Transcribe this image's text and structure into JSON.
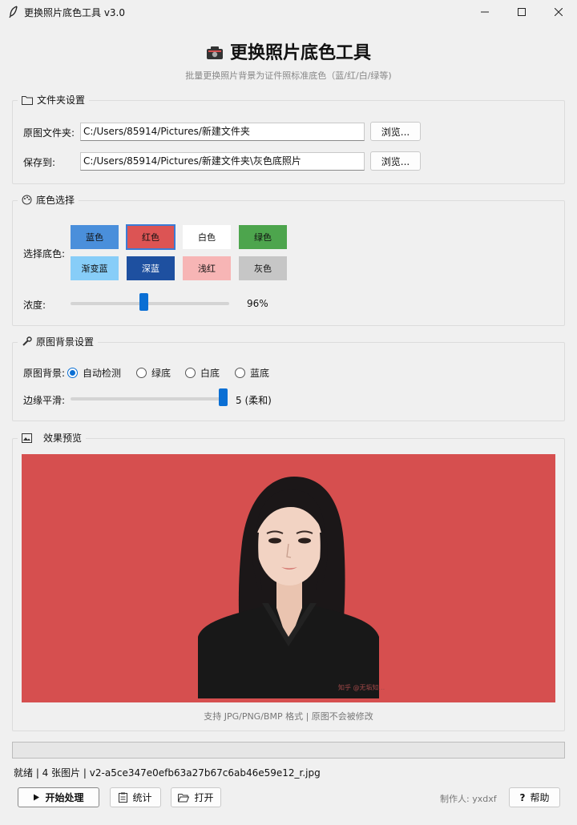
{
  "window": {
    "title": "更换照片底色工具 v3.0"
  },
  "header": {
    "title": "更换照片底色工具",
    "subtitle": "批量更换照片背景为证件照标准底色（蓝/红/白/绿等)"
  },
  "folders": {
    "legend": "文件夹设置",
    "source_label": "原图文件夹:",
    "source_value": "C:/Users/85914/Pictures/新建文件夹",
    "save_label": "保存到:",
    "save_value": "C:/Users/85914/Pictures/新建文件夹\\灰色底照片",
    "browse_label": "浏览..."
  },
  "colors": {
    "legend": "底色选择",
    "choose_label": "选择底色:",
    "swatches": [
      {
        "label": "蓝色",
        "bg": "#4a8fdb",
        "fg": "#111111"
      },
      {
        "label": "红色",
        "bg": "#dc5454",
        "fg": "#111111"
      },
      {
        "label": "白色",
        "bg": "#ffffff",
        "fg": "#111111"
      },
      {
        "label": "绿色",
        "bg": "#4da54d",
        "fg": "#111111"
      },
      {
        "label": "渐变蓝",
        "bg": "#87cdf8",
        "fg": "#111111"
      },
      {
        "label": "深蓝",
        "bg": "#1e50a0",
        "fg": "#ffffff"
      },
      {
        "label": "浅红",
        "bg": "#f7b5b5",
        "fg": "#111111"
      },
      {
        "label": "灰色",
        "bg": "#c6c6c6",
        "fg": "#111111"
      }
    ],
    "selected": "红色",
    "density_label": "浓度:",
    "density_value": "96%",
    "density_fraction": 0.46
  },
  "background": {
    "legend": "原图背景设置",
    "bg_label": "原图背景:",
    "options": [
      "自动检测",
      "绿底",
      "白底",
      "蓝底"
    ],
    "selected": "自动检测",
    "smooth_label": "边缘平滑:",
    "smooth_value": "5 (柔和)",
    "smooth_fraction": 1.0
  },
  "preview": {
    "legend": "效果预览",
    "background_color": "#d64f4f",
    "watermark": "知乎 @无垢知...",
    "note": "支持 JPG/PNG/BMP 格式 | 原图不会被修改"
  },
  "status": {
    "text": "就绪 | 4 张图片 | v2-a5ce347e0efb63a27b67c6ab46e59e12_r.jpg"
  },
  "footer": {
    "start_label": "开始处理",
    "stats_label": "统计",
    "open_label": "打开",
    "author": "制作人: yxdxf",
    "help_label": "帮助"
  }
}
